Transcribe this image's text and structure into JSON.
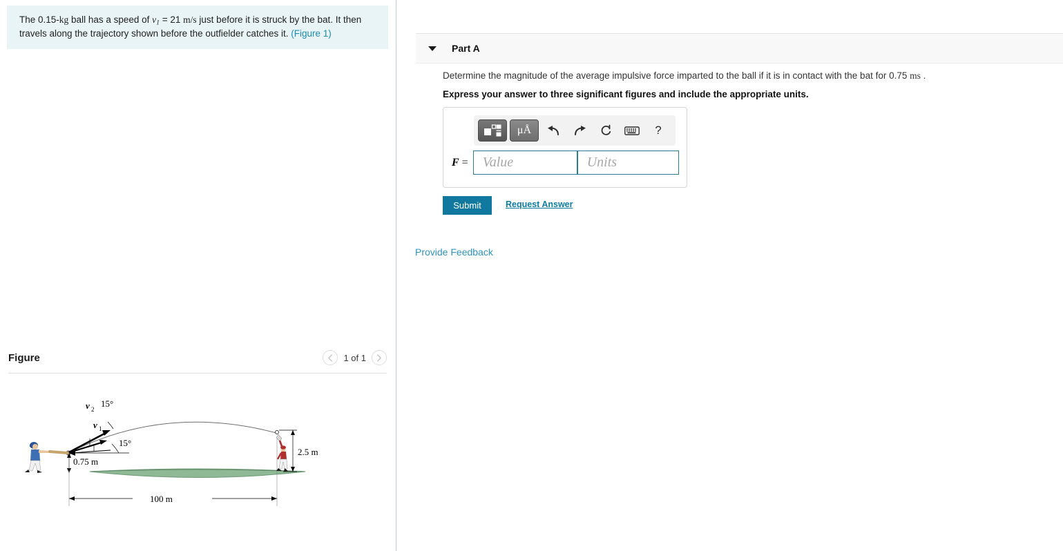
{
  "problem": {
    "text_part1": "The 0.15-",
    "mass_unit": "kg",
    "text_part2": " ball has a speed of ",
    "v_symbol": "v",
    "v_sub": "1",
    "text_part3": " = 21 ",
    "speed_unit": "m/s",
    "text_part4": " just before it is struck by the bat. It then travels along the trajectory shown before the outfielder catches it. ",
    "figure_link": "(Figure 1)"
  },
  "figure": {
    "title": "Figure",
    "counter": "1 of 1",
    "prev_icon": "chevron-left-icon",
    "next_icon": "chevron-right-icon",
    "labels": {
      "v2": "v",
      "v2_sub": "2",
      "v1": "v",
      "v1_sub": "1",
      "angle_top": "15°",
      "angle_bottom": "15°",
      "height_bat": "0.75 m",
      "height_fielder": "2.5 m",
      "distance": "100 m"
    },
    "colors": {
      "grass": "#8fb894",
      "grass_edge": "#6f9a78",
      "batter_uniform": "#3e6fb5",
      "batter_helmet": "#2a5599",
      "fielder_uniform": "#b03030",
      "bat": "#c9a46a",
      "trajectory": "#6e6e6e"
    }
  },
  "part_a": {
    "collapse_icon": "triangle-down-icon",
    "title": "Part A",
    "question_prefix": "Determine the magnitude of the average impulsive force imparted to the ball if it is in contact with the bat for 0.75 ",
    "question_unit": "ms",
    "question_suffix": " .",
    "instruction": "Express your answer to three significant figures and include the appropriate units."
  },
  "answer": {
    "toolbar": [
      {
        "name": "math-template-button",
        "icon": "math-template-icon",
        "label": ""
      },
      {
        "name": "units-button",
        "icon": "micro-angstrom-icon",
        "label": "μÅ"
      },
      {
        "name": "undo-button",
        "icon": "undo-arrow-icon",
        "label": "↰"
      },
      {
        "name": "redo-button",
        "icon": "redo-arrow-icon",
        "label": "↱"
      },
      {
        "name": "reset-button",
        "icon": "reset-circle-icon",
        "label": "↻"
      },
      {
        "name": "keyboard-button",
        "icon": "keyboard-icon",
        "label": "⌨"
      },
      {
        "name": "help-button",
        "icon": "question-mark-icon",
        "label": "?"
      }
    ],
    "field_label_var": "F",
    "field_label_eq": " =",
    "value_placeholder": "Value",
    "units_placeholder": "Units",
    "value_current": "",
    "units_current": ""
  },
  "actions": {
    "submit_label": "Submit",
    "request_answer_label": "Request Answer",
    "provide_feedback_label": "Provide Feedback"
  },
  "colors": {
    "accent_teal": "#11799f",
    "link_blue": "#2f94bd",
    "statement_bg": "#e9f4f7",
    "header_bg": "#f8f8f8",
    "divider": "#b9cfdd"
  }
}
